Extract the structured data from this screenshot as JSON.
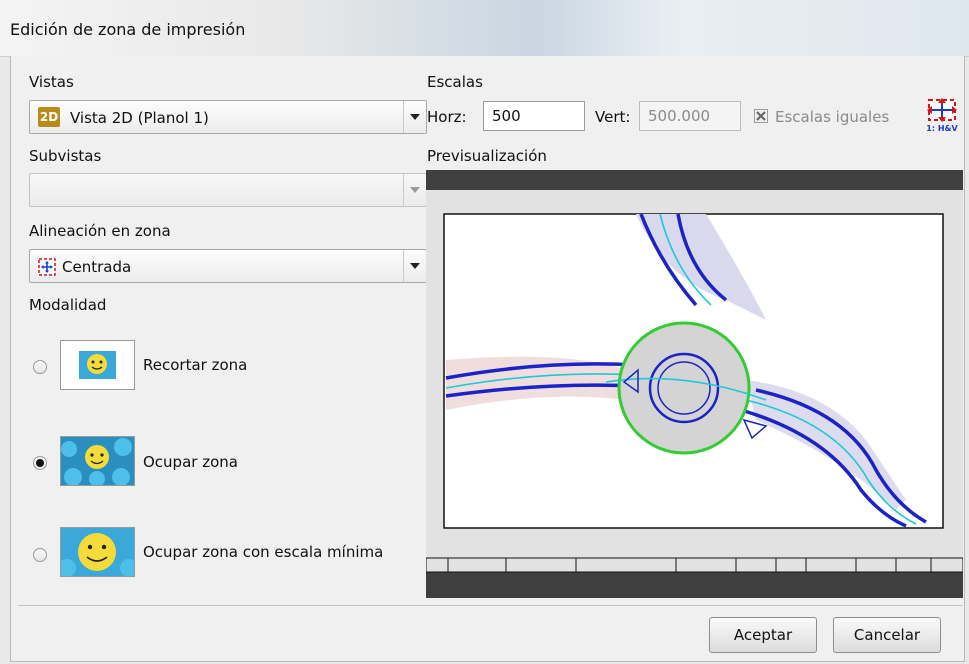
{
  "window": {
    "title": "Edición de zona de impresión"
  },
  "vistas": {
    "label": "Vistas",
    "badge": "2D",
    "value": "Vista 2D (Planol 1)"
  },
  "subvistas": {
    "label": "Subvistas",
    "value": ""
  },
  "alineacion": {
    "label": "Alineación en zona",
    "value": "Centrada",
    "icon": "center-align-icon"
  },
  "modalidad": {
    "label": "Modalidad",
    "options": [
      {
        "label": "Recortar zona",
        "selected": false
      },
      {
        "label": "Ocupar zona",
        "selected": true
      },
      {
        "label": "Ocupar zona con escala mínima",
        "selected": false
      }
    ]
  },
  "escalas": {
    "label": "Escalas",
    "horz_label": "Horz:",
    "horz_value": "500",
    "vert_label": "Vert:",
    "vert_value": "500.000",
    "equal_label": "Escalas iguales",
    "equal_checked": true,
    "hv_icon_text": "1: H&V"
  },
  "preview": {
    "label": "Previsualización"
  },
  "buttons": {
    "accept": "Aceptar",
    "cancel": "Cancelar"
  },
  "colors": {
    "road": "#1a22c8",
    "roundabout": "#33cc33",
    "axis": "#1ec8d8"
  }
}
